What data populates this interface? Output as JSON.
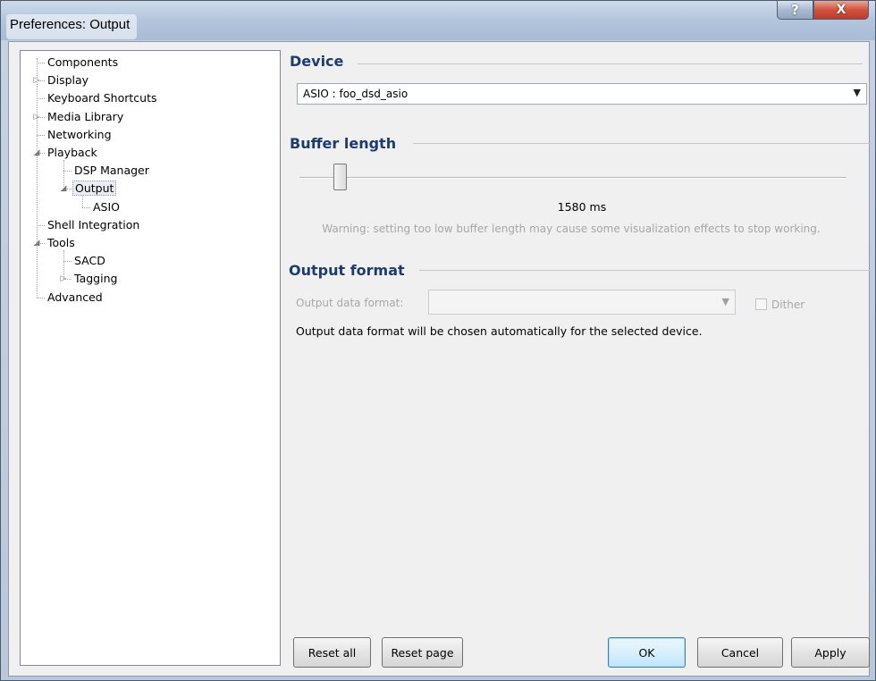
{
  "window": {
    "title": "Preferences: Output",
    "help_glyph": "?",
    "close_glyph": "X"
  },
  "tree": {
    "items": [
      {
        "label": "Components",
        "level": 0,
        "expander": ""
      },
      {
        "label": "Display",
        "level": 0,
        "expander": "collapsed"
      },
      {
        "label": "Keyboard Shortcuts",
        "level": 0,
        "expander": ""
      },
      {
        "label": "Media Library",
        "level": 0,
        "expander": "collapsed"
      },
      {
        "label": "Networking",
        "level": 0,
        "expander": ""
      },
      {
        "label": "Playback",
        "level": 0,
        "expander": "expanded"
      },
      {
        "label": "DSP Manager",
        "level": 1,
        "expander": ""
      },
      {
        "label": "Output",
        "level": 1,
        "expander": "expanded",
        "selected": true
      },
      {
        "label": "ASIO",
        "level": 2,
        "expander": ""
      },
      {
        "label": "Shell Integration",
        "level": 0,
        "expander": ""
      },
      {
        "label": "Tools",
        "level": 0,
        "expander": "expanded"
      },
      {
        "label": "SACD",
        "level": 1,
        "expander": ""
      },
      {
        "label": "Tagging",
        "level": 1,
        "expander": "collapsed"
      },
      {
        "label": "Advanced",
        "level": 0,
        "expander": ""
      }
    ],
    "expanded_glyph": "◢",
    "collapsed_glyph": "▷"
  },
  "device": {
    "title": "Device",
    "selected": "ASIO : foo_dsd_asio"
  },
  "buffer": {
    "title": "Buffer length",
    "value": "1580 ms",
    "warning": "Warning: setting too low buffer length may cause some visualization effects to stop working."
  },
  "output_format": {
    "title": "Output format",
    "data_format_label": "Output data format:",
    "data_format_value": "",
    "dither_label": "Dither",
    "info": "Output data format will be chosen automatically for the selected device."
  },
  "buttons": {
    "reset_all": "Reset all",
    "reset_page": "Reset page",
    "ok": "OK",
    "cancel": "Cancel",
    "apply": "Apply"
  }
}
